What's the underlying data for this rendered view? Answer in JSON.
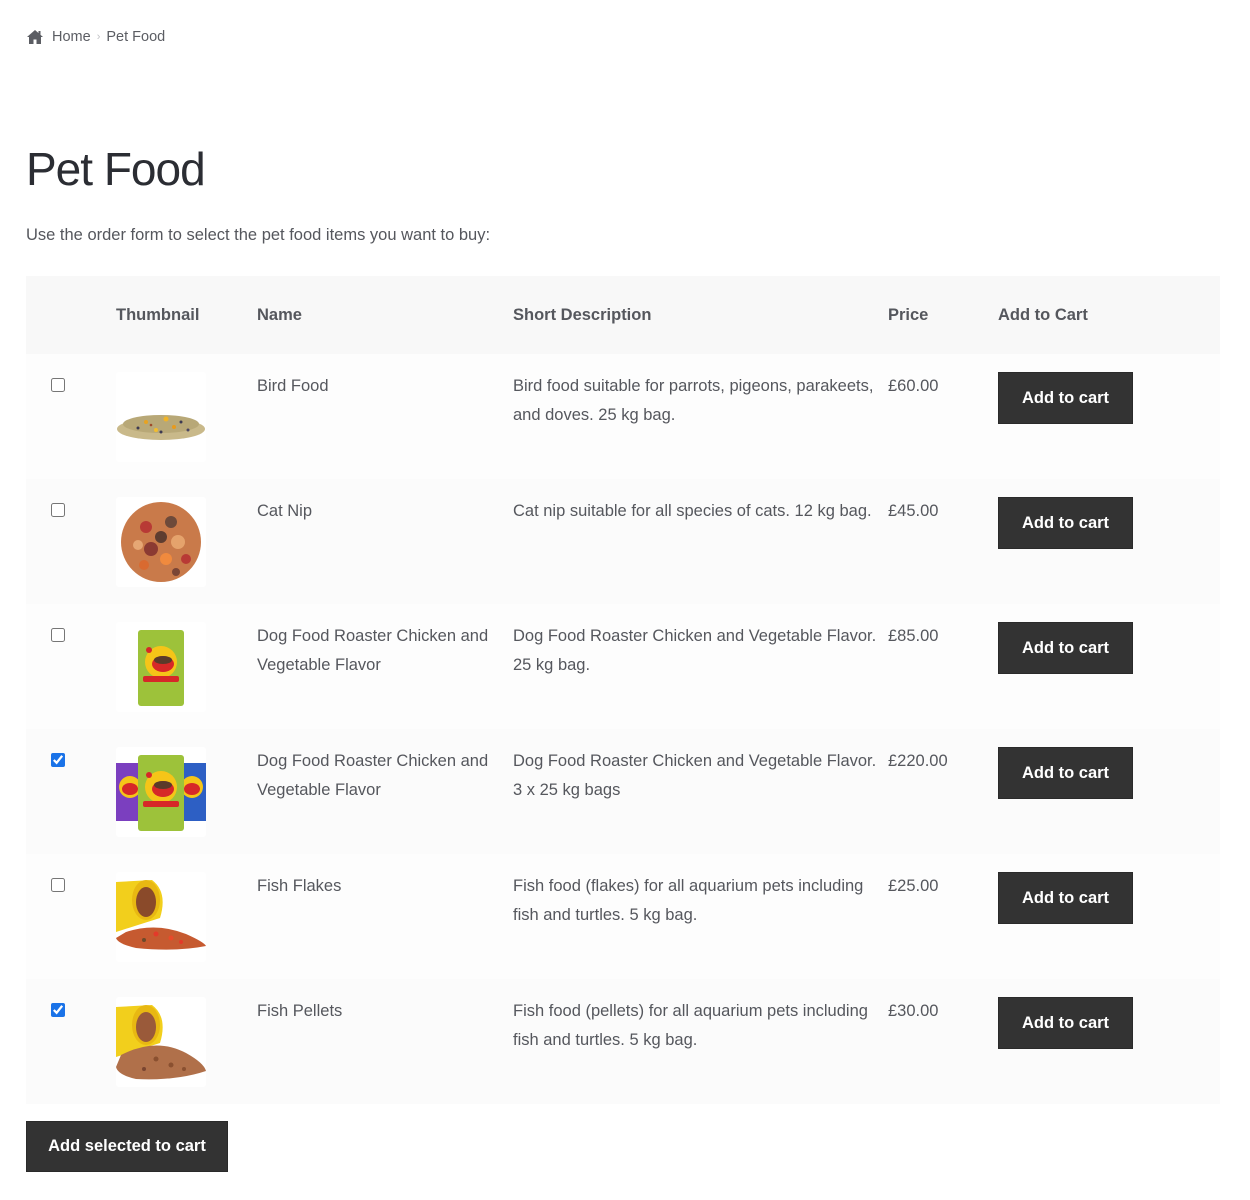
{
  "breadcrumb": {
    "home_label": "Home",
    "separator": "›",
    "current": "Pet Food"
  },
  "page": {
    "title": "Pet Food",
    "intro": "Use the order form to select the pet food items you want to buy:"
  },
  "table": {
    "headers": {
      "select": "",
      "thumbnail": "Thumbnail",
      "name": "Name",
      "description": "Short Description",
      "price": "Price",
      "add_to_cart": "Add to Cart"
    },
    "rows": [
      {
        "checked": false,
        "thumbnail": "bird-food-image",
        "name": "Bird Food",
        "description": "Bird food suitable for parrots, pigeons, parakeets, and doves. 25 kg bag.",
        "price": "£60.00",
        "button": "Add to cart"
      },
      {
        "checked": false,
        "thumbnail": "cat-nip-image",
        "name": "Cat Nip",
        "description": "Cat nip suitable for all species of cats. 12 kg bag.",
        "price": "£45.00",
        "button": "Add to cart"
      },
      {
        "checked": false,
        "thumbnail": "dog-food-bag-image",
        "name": "Dog Food Roaster Chicken and Vegetable Flavor",
        "description": "Dog Food Roaster Chicken and Vegetable Flavor. 25 kg bag.",
        "price": "£85.00",
        "button": "Add to cart"
      },
      {
        "checked": true,
        "thumbnail": "dog-food-three-bags-image",
        "name": "Dog Food Roaster Chicken and Vegetable Flavor",
        "description": "Dog Food Roaster Chicken and Vegetable Flavor. 3 x 25 kg bags",
        "price": "£220.00",
        "button": "Add to cart"
      },
      {
        "checked": false,
        "thumbnail": "fish-flakes-image",
        "name": "Fish Flakes",
        "description": "Fish food (flakes) for all aquarium pets including fish and turtles. 5 kg bag.",
        "price": "£25.00",
        "button": "Add to cart"
      },
      {
        "checked": true,
        "thumbnail": "fish-pellets-image",
        "name": "Fish Pellets",
        "description": "Fish food (pellets) for all aquarium pets including fish and turtles. 5 kg bag.",
        "price": "£30.00",
        "button": "Add to cart"
      }
    ]
  },
  "footer": {
    "add_selected_label": "Add selected to cart"
  },
  "colors": {
    "button_bg": "#333333",
    "button_text": "#ffffff",
    "header_row_bg": "#f8f8f8",
    "checkbox_accent": "#1a73e8"
  }
}
